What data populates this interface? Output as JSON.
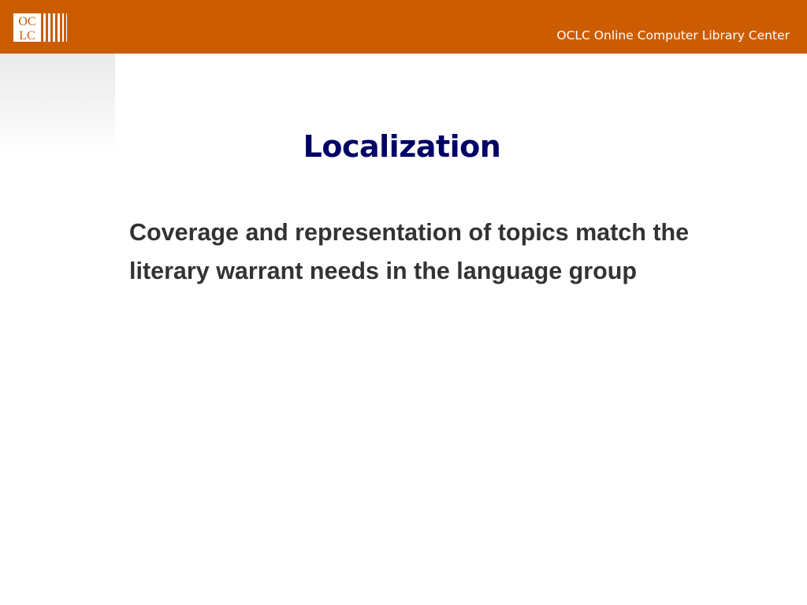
{
  "header": {
    "logo": {
      "text_top": "OC",
      "text_bottom": "LC",
      "icon": "oclc-logo-icon"
    },
    "org_name": "OCLC Online Computer Library Center"
  },
  "slide": {
    "title": "Localization",
    "body_lines": [
      "Coverage and representation of topics match the",
      "literary warrant needs in the language group"
    ]
  },
  "colors": {
    "header_bg": "#cc5c00",
    "header_text": "#ffffff",
    "title": "#000066",
    "body": "#333333"
  }
}
